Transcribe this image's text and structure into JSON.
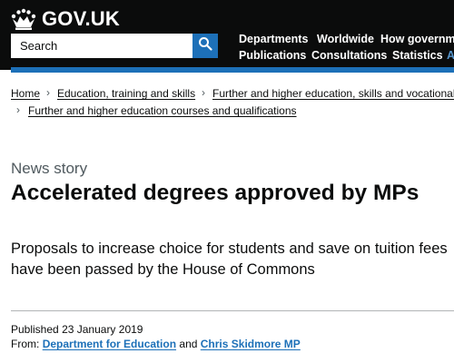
{
  "header": {
    "logo_text": "GOV.UK",
    "search": {
      "placeholder": "Search"
    },
    "nav": [
      {
        "label": "Departments"
      },
      {
        "label": "Worldwide"
      },
      {
        "label": "How governme"
      },
      {
        "label": "Publications"
      },
      {
        "label": "Consultations"
      },
      {
        "label": "Statistics"
      },
      {
        "label": "A"
      }
    ]
  },
  "breadcrumb": [
    {
      "label": "Home"
    },
    {
      "label": "Education, training and skills"
    },
    {
      "label": "Further and higher education, skills and vocational"
    },
    {
      "label": "Further and higher education courses and qualifications"
    }
  ],
  "article": {
    "type": "News story",
    "title": "Accelerated degrees approved by MPs",
    "summary": "Proposals to increase choice for students and save on tuition fees have been passed by the House of Commons",
    "published_label": "Published",
    "published_date": "23 January 2019",
    "from_label": "From:",
    "org_1": "Department for Education",
    "conjunction": "and",
    "org_2": "Chris Skidmore MP"
  },
  "colors": {
    "header_bg": "#0b0c0c",
    "brand_blue": "#1d70b8",
    "text": "#0b0c0c",
    "secondary_text": "#505a5f"
  },
  "icons": {
    "crown": "crown-icon",
    "search": "search-icon",
    "chevron": "chevron-right-icon"
  }
}
